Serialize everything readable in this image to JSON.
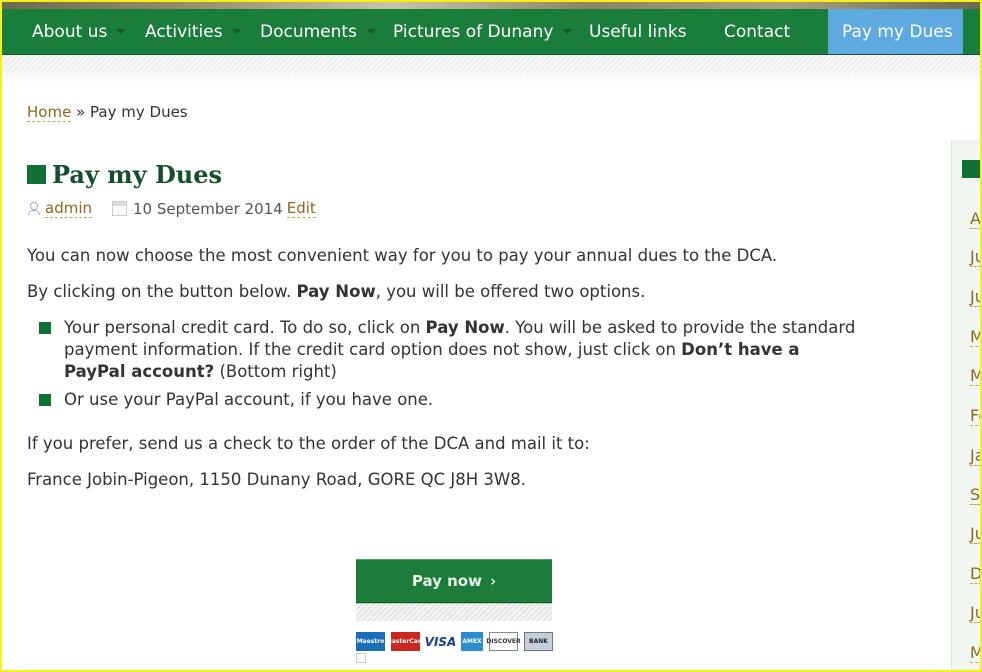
{
  "nav": {
    "items": [
      {
        "label": "About us",
        "dropdown": true
      },
      {
        "label": "Activities",
        "dropdown": true
      },
      {
        "label": "Documents",
        "dropdown": true
      },
      {
        "label": "Pictures of Dunany",
        "dropdown": true
      },
      {
        "label": "Useful links",
        "dropdown": false
      },
      {
        "label": "Contact",
        "dropdown": false
      },
      {
        "label": "Pay my Dues",
        "dropdown": false,
        "active": true
      }
    ]
  },
  "breadcrumb": {
    "home": "Home",
    "separator": "»",
    "current": "Pay my Dues"
  },
  "post": {
    "title": "Pay my Dues",
    "author": "admin",
    "date": "10 September 2014",
    "edit": "Edit",
    "para1": "You can now choose the most convenient way for you to pay your annual dues to the DCA.",
    "para2_before": "By clicking on the button below. ",
    "para2_bold": "Pay Now",
    "para2_after": ", you will be offered two options.",
    "bullet1_a": "Your personal credit card. To do so, click on ",
    "bullet1_bold1": "Pay Now",
    "bullet1_b": ". You will be asked to provide the standard payment information. If the credit card option does not show, just click on ",
    "bullet1_bold2": "Don’t have a PayPal account?",
    "bullet1_c": " (Bottom right)",
    "bullet2": "Or use your PayPal account, if you have one.",
    "para3": "If you prefer, send us a check to the order of the DCA and mail it to:",
    "para4": "France Jobin-Pigeon, 1150 Dunany Road, GORE QC J8H 3W8."
  },
  "paypal": {
    "button_label": "Pay now",
    "cards": [
      "Maestro",
      "MasterCard",
      "VISA",
      "AMEX",
      "DISCOVER",
      "BANK"
    ]
  },
  "sidebar": {
    "items": [
      "A",
      "Ju",
      "Ju",
      "M",
      "M",
      "Fe",
      "Ja",
      "S",
      "Ju",
      "D",
      "Ju",
      "M"
    ]
  },
  "colors": {
    "nav_bg": "#1a7d3c",
    "nav_active": "#5ea9e0",
    "accent_green": "#137034",
    "link": "#8a6a1f"
  }
}
